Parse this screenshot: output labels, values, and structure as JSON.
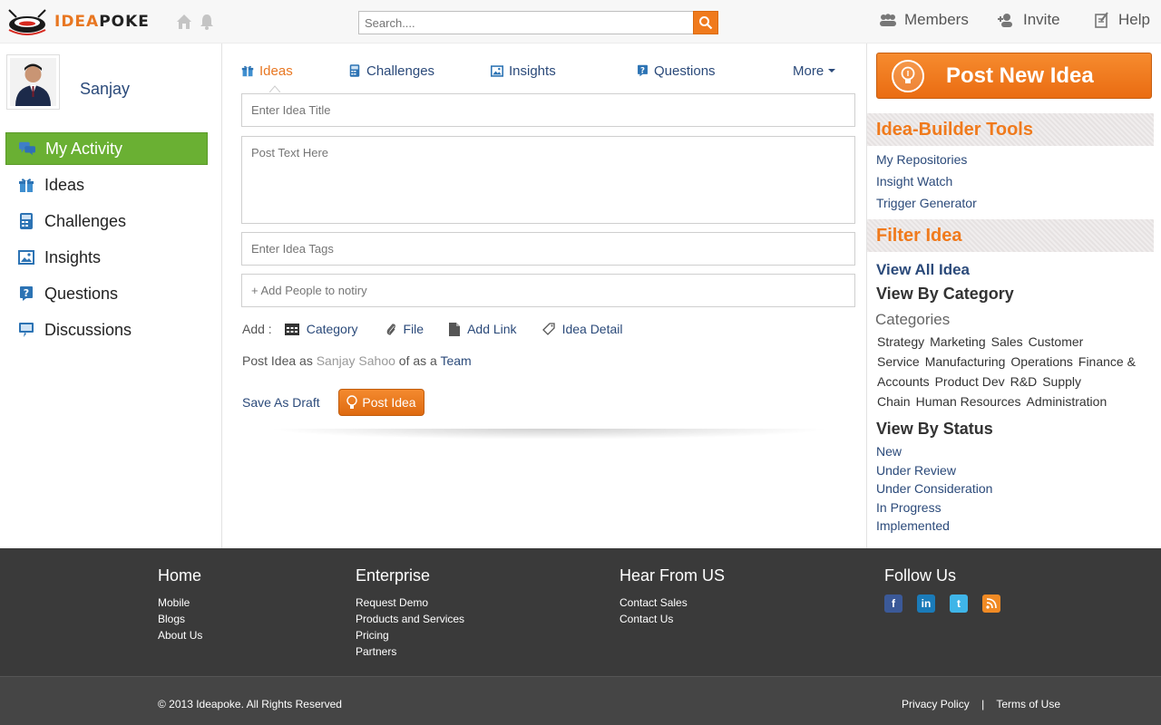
{
  "header": {
    "logo_text_1": "IDEA",
    "logo_text_2": "POKE",
    "search_placeholder": "Search....",
    "links": [
      "Members",
      "Invite",
      "Help"
    ]
  },
  "profile": {
    "name": "Sanjay"
  },
  "sidebar": {
    "items": [
      {
        "label": "My Activity",
        "icon": "chat-icon",
        "active": true
      },
      {
        "label": "Ideas",
        "icon": "gift-icon"
      },
      {
        "label": "Challenges",
        "icon": "calculator-icon"
      },
      {
        "label": "Insights",
        "icon": "picture-icon"
      },
      {
        "label": "Questions",
        "icon": "question-icon"
      },
      {
        "label": "Discussions",
        "icon": "monitor-icon"
      }
    ]
  },
  "tabs": [
    "Ideas",
    "Challenges",
    "Insights",
    "Questions",
    "More"
  ],
  "form": {
    "title_placeholder": "Enter Idea Title",
    "text_placeholder": "Post Text Here",
    "tags_placeholder": "Enter Idea Tags",
    "people_placeholder": "+ Add People to notiry",
    "add_label": "Add :",
    "add_items": [
      "Category",
      "File",
      "Add Link",
      "Idea Detail"
    ],
    "postas_prefix": "Post Idea as",
    "postas_name": "Sanjay Sahoo",
    "postas_mid": "of as a",
    "postas_team": "Team",
    "save_draft": "Save As Draft",
    "post_button": "Post Idea"
  },
  "right": {
    "post_new_idea": "Post New Idea",
    "tools_heading": "Idea-Builder Tools",
    "tools": [
      "My Repositories",
      "Insight Watch",
      "Trigger Generator"
    ],
    "filter_heading": "Filter Idea",
    "view_all": "View All Idea",
    "view_by_category": "View By Category",
    "categories_label": "Categories",
    "categories": [
      "Strategy",
      "Marketing",
      "Sales",
      "Customer Service",
      "Manufacturing",
      "Operations",
      "Finance & Accounts",
      "Product Dev",
      "R&D",
      "Supply Chain",
      "Human Resources",
      "Administration"
    ],
    "view_by_status": "View By Status",
    "statuses": [
      "New",
      "Under Review",
      "Under Consideration",
      "In Progress",
      "Implemented"
    ]
  },
  "footer": {
    "columns": [
      {
        "heading": "Home",
        "links": [
          "Mobile",
          "Blogs",
          "About Us"
        ]
      },
      {
        "heading": "Enterprise",
        "links": [
          "Request Demo",
          "Products and Services",
          "Pricing",
          "Partners"
        ]
      },
      {
        "heading": "Hear From US",
        "links": [
          "Contact Sales",
          "Contact Us"
        ]
      },
      {
        "heading": "Follow Us",
        "links": []
      }
    ],
    "social": [
      "facebook-icon",
      "linkedin-icon",
      "twitter-icon",
      "rss-icon"
    ],
    "copyright": "© 2013 Ideapoke. All Rights Reserved",
    "privacy": "Privacy Policy",
    "separator": "|",
    "terms": "Terms of Use"
  },
  "colors": {
    "accent": "#f07a1c",
    "link": "#2b4a7a",
    "active_nav": "#6ab033",
    "footer_bg": "#3a3a3a"
  }
}
